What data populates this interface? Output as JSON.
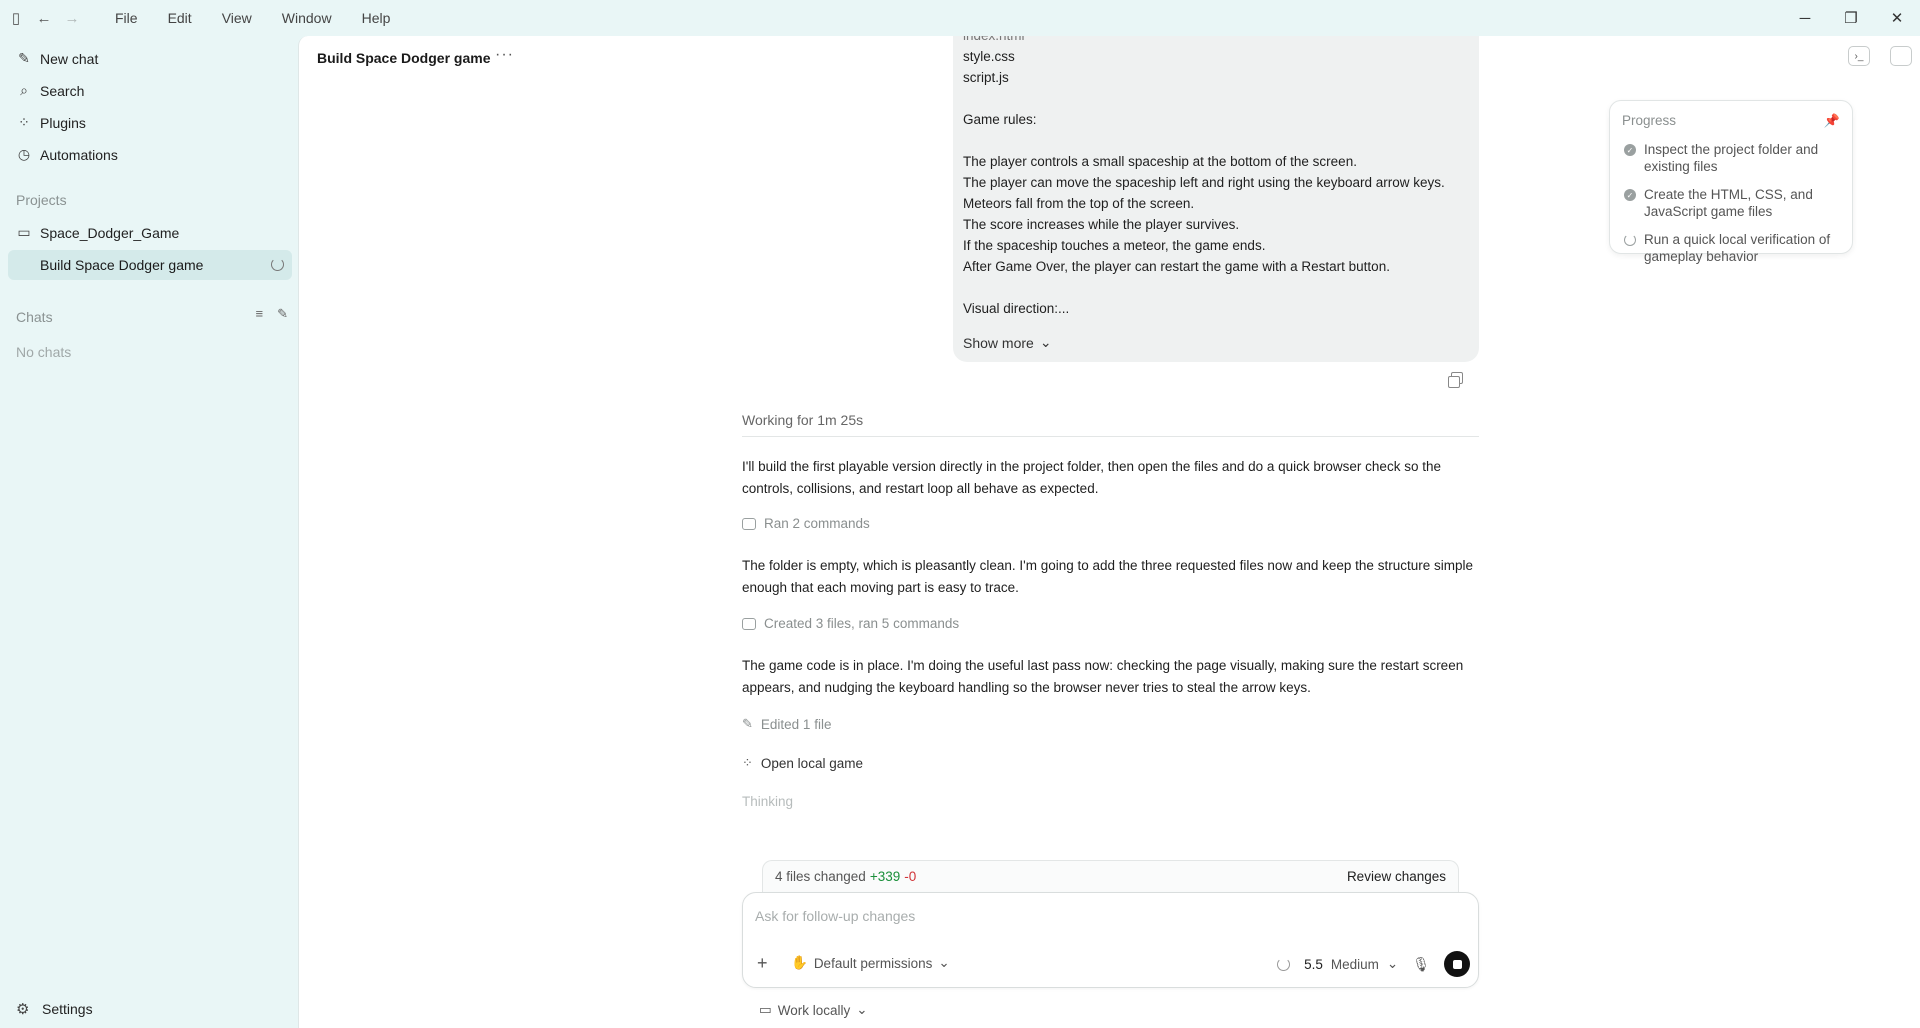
{
  "menu": [
    "File",
    "Edit",
    "View",
    "Window",
    "Help"
  ],
  "sidebar": {
    "new_chat": "New chat",
    "search": "Search",
    "plugins": "Plugins",
    "automations": "Automations",
    "projects_heading": "Projects",
    "project_folder": "Space_Dodger_Game",
    "active_chat": "Build Space Dodger game",
    "chats_heading": "Chats",
    "no_chats": "No chats",
    "settings": "Settings"
  },
  "main": {
    "chat_title": "Build Space Dodger game",
    "user_message": {
      "lines": [
        "index.html",
        "style.css",
        "script.js",
        "",
        "Game rules:",
        "",
        "The player controls a small spaceship at the bottom of the screen.",
        "The player can move the spaceship left and right using the keyboard arrow keys.",
        "Meteors fall from the top of the screen.",
        "The score increases while the player survives.",
        "If the spaceship touches a meteor, the game ends.",
        "After Game Over, the player can restart the game with a Restart button.",
        "",
        "Visual direction:..."
      ],
      "show_more": "Show more"
    },
    "working": "Working for 1m 25s",
    "para1": "I'll build the first playable version directly in the project folder, then open the files and do a quick browser check so the controls, collisions, and restart loop all behave as expected.",
    "activity1": "Ran 2 commands",
    "para2": "The folder is empty, which is pleasantly clean. I'm going to add the three requested files now and keep the structure simple enough that each moving part is easy to trace.",
    "activity2": "Created 3 files, ran 5 commands",
    "para3": "The game code is in place. I'm doing the useful last pass now: checking the page visually, making sure the restart screen appears, and nudging the keyboard handling so the browser never tries to steal the arrow keys.",
    "activity3": "Edited 1 file",
    "activity4": "Open local game",
    "thinking": "Thinking"
  },
  "changes": {
    "files_changed": "4 files changed",
    "added": "+339",
    "removed": "-0",
    "review": "Review changes"
  },
  "composer": {
    "placeholder": "Ask for follow-up changes",
    "permissions": "Default permissions",
    "model": "5.5",
    "effort": "Medium",
    "work_locally": "Work locally"
  },
  "progress": {
    "title": "Progress",
    "steps": [
      {
        "text": "Inspect the project folder and existing files",
        "status": "done"
      },
      {
        "text": "Create the HTML, CSS, and JavaScript game files",
        "status": "done"
      },
      {
        "text": "Run a quick local verification of gameplay behavior",
        "status": "in-progress"
      }
    ]
  },
  "colors": {
    "sidebar_bg": "#e9f6f6",
    "active_item_bg": "#d4eaea",
    "added": "#1a8f3a",
    "removed": "#d13438"
  }
}
